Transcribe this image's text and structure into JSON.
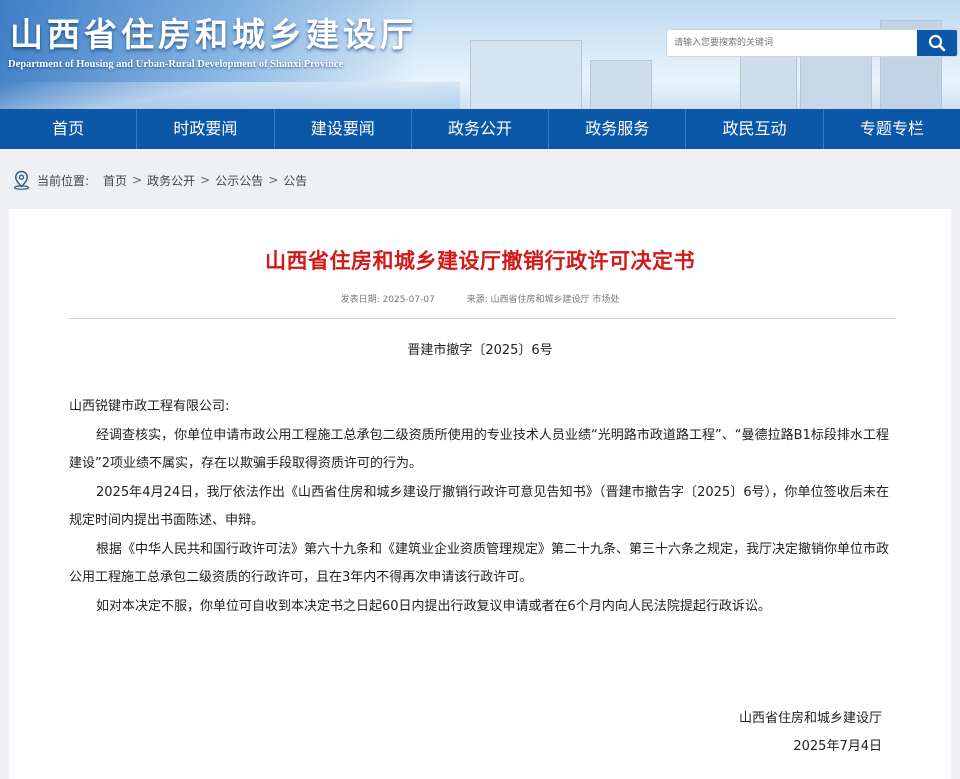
{
  "header": {
    "title": "山西省住房和城乡建设厅",
    "subtitle": "Department of Housing and Urban-Rural Development of Shanxi Province",
    "search_placeholder": "请输入您要搜索的关键词",
    "search_icon": "search-icon"
  },
  "nav": {
    "items": [
      {
        "label": "首页"
      },
      {
        "label": "时政要闻"
      },
      {
        "label": "建设要闻"
      },
      {
        "label": "政务公开"
      },
      {
        "label": "政务服务"
      },
      {
        "label": "政民互动"
      },
      {
        "label": "专题专栏"
      }
    ]
  },
  "breadcrumb": {
    "icon": "location-pin-icon",
    "label": "当前位置:",
    "items": [
      "首页",
      "政务公开",
      "公示公告",
      "公告"
    ],
    "separator": ">"
  },
  "article": {
    "title": "山西省住房和城乡建设厅撤销行政许可决定书",
    "publish_label": "发表日期:",
    "publish_date": "2025-07-07",
    "source_label": "来源:",
    "source": "山西省住房和城乡建设厅 市场处",
    "doc_number": "晋建市撤字〔2025〕6号",
    "addressee": "山西锐键市政工程有限公司:",
    "paragraphs": [
      "经调查核实，你单位申请市政公用工程施工总承包二级资质所使用的专业技术人员业绩“光明路市政道路工程”、“曼德拉路B1标段排水工程建设”2项业绩不属实，存在以欺骗手段取得资质许可的行为。",
      "2025年4月24日，我厅依法作出《山西省住房和城乡建设厅撤销行政许可意见告知书》（晋建市撤告字〔2025〕6号），你单位签收后未在规定时间内提出书面陈述、申辩。",
      "根据《中华人民共和国行政许可法》第六十九条和《建筑业企业资质管理规定》第二十九条、第三十六条之规定，我厅决定撤销你单位市政公用工程施工总承包二级资质的行政许可，且在3年内不得再次申请该行政许可。",
      "如对本决定不服，你单位可自收到本决定书之日起60日内提出行政复议申请或者在6个月内向人民法院提起行政诉讼。"
    ],
    "signature_org": "山西省住房和城乡建设厅",
    "signature_date": "2025年7月4日"
  },
  "colors": {
    "nav_bg": "#0c58a8",
    "title_red": "#d01a1a",
    "page_bg": "#eef0f3"
  }
}
